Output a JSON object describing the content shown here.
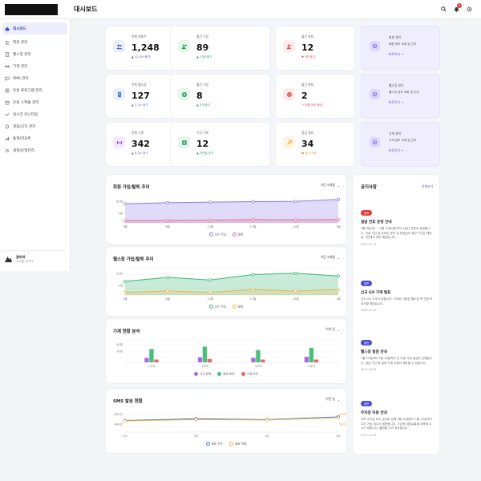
{
  "header": {
    "title": "대시보드"
  },
  "sidebar": {
    "items": [
      {
        "label": "대시보드",
        "icon": "home-icon",
        "active": true
      },
      {
        "label": "회원 관리",
        "icon": "users-icon"
      },
      {
        "label": "헬스장 관리",
        "icon": "building-icon"
      },
      {
        "label": "기계 관리",
        "icon": "machine-icon"
      },
      {
        "label": "SMS 관리",
        "icon": "message-icon"
      },
      {
        "label": "운동 프로그램 관리",
        "icon": "program-icon"
      },
      {
        "label": "운동 스케줄 관리",
        "icon": "calendar-icon"
      },
      {
        "label": "실시간 모니터링",
        "icon": "monitor-icon"
      },
      {
        "label": "알림/공지 관리",
        "icon": "bell-icon"
      },
      {
        "label": "통계/리포트",
        "icon": "report-icon"
      },
      {
        "label": "설정/운영관리",
        "icon": "settings-icon"
      }
    ],
    "user": {
      "name": "관리자",
      "role": "시스템 관리자"
    }
  },
  "notifications": {
    "count": "3"
  },
  "stats": [
    {
      "label": "전체 회원수",
      "value": "1,248",
      "delta": "▲ 12.5% 증가",
      "color": "#4a4fd4",
      "bg": "#ecedfb",
      "icon": "users-icon"
    },
    {
      "label": "월간 가입",
      "value": "89",
      "delta": "▲ 23명 증가",
      "color": "#2e9e5a",
      "bg": "#e6f6ec",
      "icon": "user-plus-icon"
    },
    {
      "label": "월간 탈퇴",
      "value": "12",
      "delta": "▼ 3명 증가",
      "color": "#e05252",
      "bg": "#fdecec",
      "icon": "user-minus-icon"
    },
    {
      "label": "전체 헬스장",
      "value": "127",
      "delta": "▲ 3.2% 증가",
      "color": "#4a7fd4",
      "bg": "#e8f0fc",
      "icon": "building-icon"
    },
    {
      "label": "월간 가입",
      "value": "8",
      "delta": "▲ 3개 증가",
      "color": "#2e9e5a",
      "bg": "#e6f6ec",
      "icon": "plus-circle-icon"
    },
    {
      "label": "월간 탈퇴",
      "value": "2",
      "delta": "→ 전월 대비 동일",
      "color": "#e05252",
      "bg": "#fdecec",
      "icon": "minus-circle-icon"
    },
    {
      "label": "전체 기계",
      "value": "342",
      "delta": "▲ 8.2% 증가",
      "color": "#9b4fd4",
      "bg": "#f3eafc",
      "icon": "dumbbell-icon"
    },
    {
      "label": "신규 기계",
      "value": "12",
      "delta": "▲ 이번달 추가",
      "color": "#2e9e5a",
      "bg": "#e6f6ec",
      "icon": "plus-square-icon"
    },
    {
      "label": "점검 필요",
      "value": "34",
      "delta": "● 점검 진행",
      "color": "#e0a030",
      "bg": "#fdf3e3",
      "icon": "wrench-icon"
    }
  ],
  "quick_links": [
    {
      "title": "회원 관리",
      "desc": "회원 정보 조회 및 관리",
      "link": "바로가기 →"
    },
    {
      "title": "헬스장 관리",
      "desc": "헬스장 정보 조회 및 관리",
      "link": "바로가기 →"
    },
    {
      "title": "기계 관리",
      "desc": "기계 정보 조회 및 관리",
      "link": "바로가기 →"
    }
  ],
  "charts": [
    {
      "title": "회원 가입/탈퇴 추이",
      "select": "최근 6개월",
      "chart_data": {
        "type": "area",
        "categories": [
          "5월",
          "6월",
          "10월",
          "11월",
          "12월",
          "1월"
        ],
        "ylim": [
          0,
          100
        ],
        "yticks": [
          "80명",
          "0명"
        ],
        "series": [
          {
            "name": "신규 가입",
            "values": [
              70,
              74,
              76,
              78,
              79,
              86
            ],
            "color": "#8b7fe8"
          },
          {
            "name": "탈퇴",
            "values": [
              8,
              9,
              10,
              12,
              11,
              12
            ],
            "color": "#e86b8a"
          }
        ]
      }
    },
    {
      "title": "헬스장 가입/탈퇴 추이",
      "select": "최근 6개월",
      "chart_data": {
        "type": "area",
        "categories": [
          "5월",
          "6월",
          "10월",
          "11월",
          "12월",
          "1월"
        ],
        "ylim": [
          0,
          10
        ],
        "yticks": [
          "10개",
          "0개"
        ],
        "series": [
          {
            "name": "신규 가입",
            "values": [
              5,
              6.5,
              5.5,
              7.5,
              8,
              7
            ],
            "color": "#3cb878"
          },
          {
            "name": "탈퇴",
            "values": [
              1,
              1.5,
              1,
              2,
              1.5,
              2
            ],
            "color": "#e8b84a"
          }
        ]
      }
    },
    {
      "title": "기계 현황 분석",
      "select": "이번 달",
      "chart_data": {
        "type": "bar",
        "categories": [
          "1주차",
          "2주차",
          "3주차",
          "4주차"
        ],
        "ylim": [
          0,
          40
        ],
        "yticks": [
          "40대",
          "20대"
        ],
        "series": [
          {
            "name": "신규 등록",
            "values": [
              8,
              9,
              8,
              10
            ],
            "color": "#a86ee0"
          },
          {
            "name": "점검 완료",
            "values": [
              24,
              28,
              22,
              26
            ],
            "color": "#4cc07a"
          },
          {
            "name": "고장/수리",
            "values": [
              5,
              6,
              5,
              5
            ],
            "color": "#e86868"
          }
        ]
      }
    },
    {
      "title": "SMS 발송 현황",
      "select": "이번 달",
      "chart_data": {
        "type": "line",
        "categories": [
          "1주",
          "2주",
          "3주",
          "4주"
        ],
        "ylim": [
          0,
          1000
        ],
        "yticks": [
          "800건",
          "400건"
        ],
        "y2ticks": [
          "1,000건",
          "500건"
        ],
        "series": [
          {
            "name": "발송 건수",
            "values": [
              520,
              600,
              560,
              680
            ],
            "color": "#4a7fd4"
          },
          {
            "name": "발송 비용",
            "values": [
              500,
              560,
              540,
              640
            ],
            "color": "#e8b84a"
          }
        ]
      }
    }
  ],
  "notices": {
    "title": "공지사항",
    "more": "전체보기",
    "items": [
      {
        "tag": "중요",
        "tag_color": "#e53935",
        "title": "설날 연휴 운영 안내",
        "body": "2월 9일(토) ~ 2월 12일(화)까지 4일간 연휴로 운영됩니다. 연휴 기간 중 온라인 문의 및 운영업무 휴관 기간은 예정된 기간에서 처리 예정입니다.",
        "date": "2025.01.15"
      },
      {
        "tag": "일반",
        "tag_color": "#4a4fd4",
        "title": "신규 GX 기계 발표",
        "body": "신규 GX 기계 도입합니다. 자세한 사항은 헬스장 측 변경 후 공지할 예정입니다.",
        "date": "2025.01.10"
      },
      {
        "tag": "일반",
        "tag_color": "#4a4fd4",
        "title": "헬스장 점검 안내",
        "body": "1월 15일부터 1월 16일까지 전 지점 기계 점검이 진행됩니다. 점검 기간 중 일부 기계 이용이 제한될 수 있습니다.",
        "date": "2025.01.05"
      },
      {
        "tag": "일반",
        "tag_color": "#4a4fd4",
        "title": "주차장 이용 안내",
        "body": "지하 주차장 보수 공사로 인해 1월 20일부터 1월 25일까지 주차 가능 대수가 제한됩니다. 가급적 대중교통을 이용해 주시기 바랍니다. 불편을 드려 죄송합니다.",
        "date": "2025.01.03"
      }
    ]
  }
}
